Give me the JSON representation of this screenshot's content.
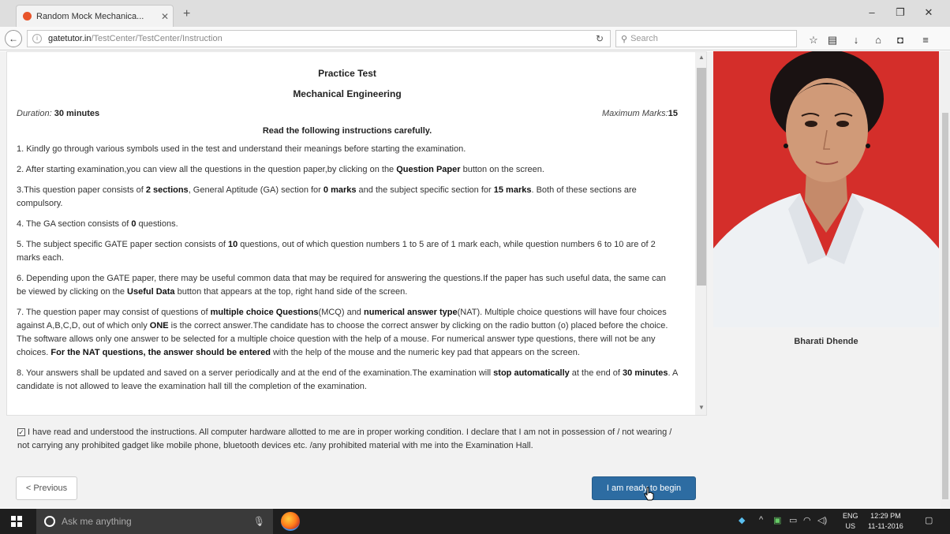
{
  "browser": {
    "tab_title": "Random Mock Mechanica...",
    "tab_close": "✕",
    "new_tab": "+",
    "url_host": "gatetutor.in",
    "url_path": "/TestCenter/TestCenter/Instruction",
    "search_placeholder": "Search",
    "window_controls": [
      "–",
      "❐",
      "✕"
    ]
  },
  "test": {
    "title": "Practice Test",
    "subject": "Mechanical Engineering",
    "duration_label": "Duration:",
    "duration_value": "30 minutes",
    "max_marks_label": "Maximum Marks:",
    "max_marks_value": "15",
    "read_heading": "Read the following instructions carefully."
  },
  "instructions": {
    "i1": "1. Kindly go through various symbols used in the test and understand their meanings before starting the examination.",
    "i2a": "2. After starting examination,you can view all the questions in the question paper,by clicking on the ",
    "i2b": "Question Paper",
    "i2c": " button on the screen.",
    "i3a": "3.This question paper consists of ",
    "i3b": "2 sections",
    "i3c": ", General Aptitude (GA) section for ",
    "i3d": "0 marks",
    "i3e": " and the subject specific section for ",
    "i3f": "15 marks",
    "i3g": ". Both of these sections are compulsory.",
    "i4a": "4. The GA section consists of ",
    "i4b": "0",
    "i4c": " questions.",
    "i5a": "5. The subject specific GATE paper section consists of ",
    "i5b": "10",
    "i5c": " questions, out of which question numbers 1 to 5 are of 1 mark each, while question numbers 6 to 10 are of 2 marks each.",
    "i6a": "6. Depending upon the GATE paper, there may be useful common data that may be required for answering the questions.If the paper has such useful data, the same can be viewed by clicking on the ",
    "i6b": "Useful Data",
    "i6c": " button that appears at the top, right hand side of the screen.",
    "i7a": "7. The question paper may consist of questions of ",
    "i7b": "multiple choice Questions",
    "i7c": "(MCQ) and ",
    "i7d": "numerical answer type",
    "i7e": "(NAT). Multiple choice questions will have four choices against A,B,C,D, out of which only ",
    "i7f": "ONE",
    "i7g": " is the correct answer.The candidate has to choose the correct answer by clicking on the radio button (o) placed before the choice. The software allows only one answer to be selected for a multiple choice question with the help of a mouse. For numerical answer type questions, there will not be any choices. ",
    "i7h": "For the NAT questions, the answer should be entered",
    "i7i": " with the help of the mouse and the numeric key pad that appears on the screen.",
    "i8a": "8. Your answers shall be updated and saved on a server periodically and at the end of the examination.The examination will ",
    "i8b": "stop automatically",
    "i8c": " at the end of ",
    "i8d": "30 minutes",
    "i8e": ". A candidate is not allowed to leave the examination hall till the completion of the examination."
  },
  "declaration": {
    "checked": "☑",
    "text": "I have read and understood the instructions. All computer hardware allotted to me are in proper working condition. I declare that I am not in possession of / not wearing / not carrying any prohibited gadget like mobile phone, bluetooth devices etc. /any prohibited material with me into the Examination Hall."
  },
  "buttons": {
    "previous": "< Previous",
    "ready": "I am ready to begin"
  },
  "candidate": {
    "name": "Bharati Dhende"
  },
  "taskbar": {
    "search_placeholder": "Ask me anything",
    "lang_top": "ENG",
    "lang_bottom": "US",
    "time": "12:29 PM",
    "date": "11-11-2016"
  }
}
